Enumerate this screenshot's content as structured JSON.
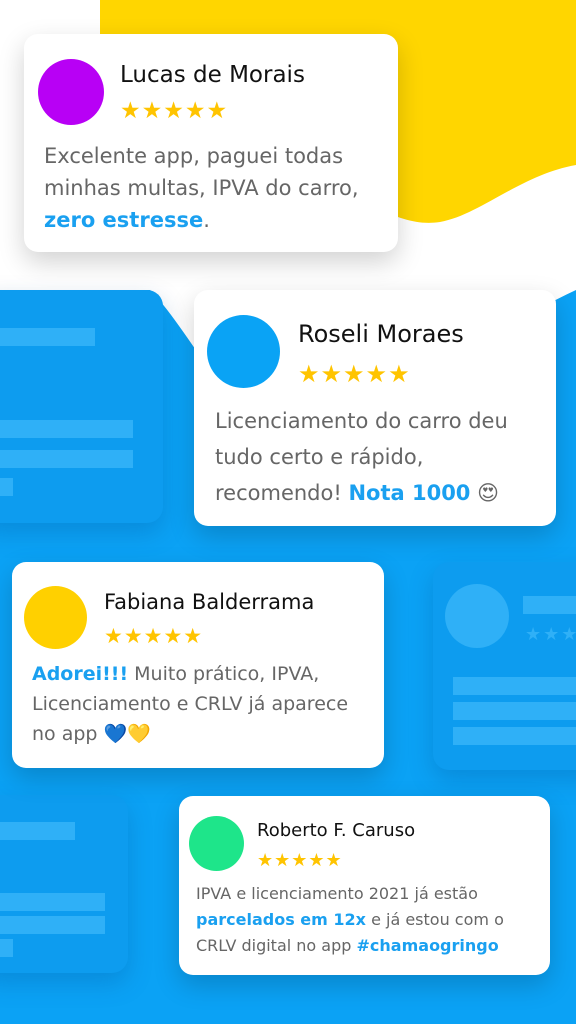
{
  "colors": {
    "yellow": "#ffd600",
    "blue": "#0ba2f5",
    "highlight": "#1aa0f0",
    "star": "#ffc400"
  },
  "reviews": [
    {
      "name": "Lucas de Morais",
      "stars": "★★★★★",
      "avatar_color": "#b800f5",
      "text_before": "Excelente app, paguei todas minhas multas, IPVA do carro, ",
      "highlight": "zero estresse",
      "text_after": "."
    },
    {
      "name": "Roseli Moraes",
      "stars": "★★★★★",
      "avatar_color": "#0aa3f5",
      "text_before": "Licenciamento do carro deu tudo certo e rápido, recomendo! ",
      "highlight": "Nota 1000",
      "emoji": "😍"
    },
    {
      "name": "Fabiana Balderrama",
      "stars": "★★★★★",
      "avatar_color": "#ffd000",
      "highlight": "Adorei!!!",
      "text_after": " Muito prático, IPVA, Licenciamento e CRLV já aparece no app ",
      "emoji": "💙💛"
    },
    {
      "name": "Roberto F. Caruso",
      "stars": "★★★★★",
      "avatar_color": "#1ee58a",
      "text_before": "IPVA e licenciamento 2021 já estão ",
      "highlight": "parcelados em 12x",
      "text_middle": " e já estou com o CRLV digital no app ",
      "highlight2": "#chamaogringo"
    }
  ],
  "ghost_stars": "★★★"
}
